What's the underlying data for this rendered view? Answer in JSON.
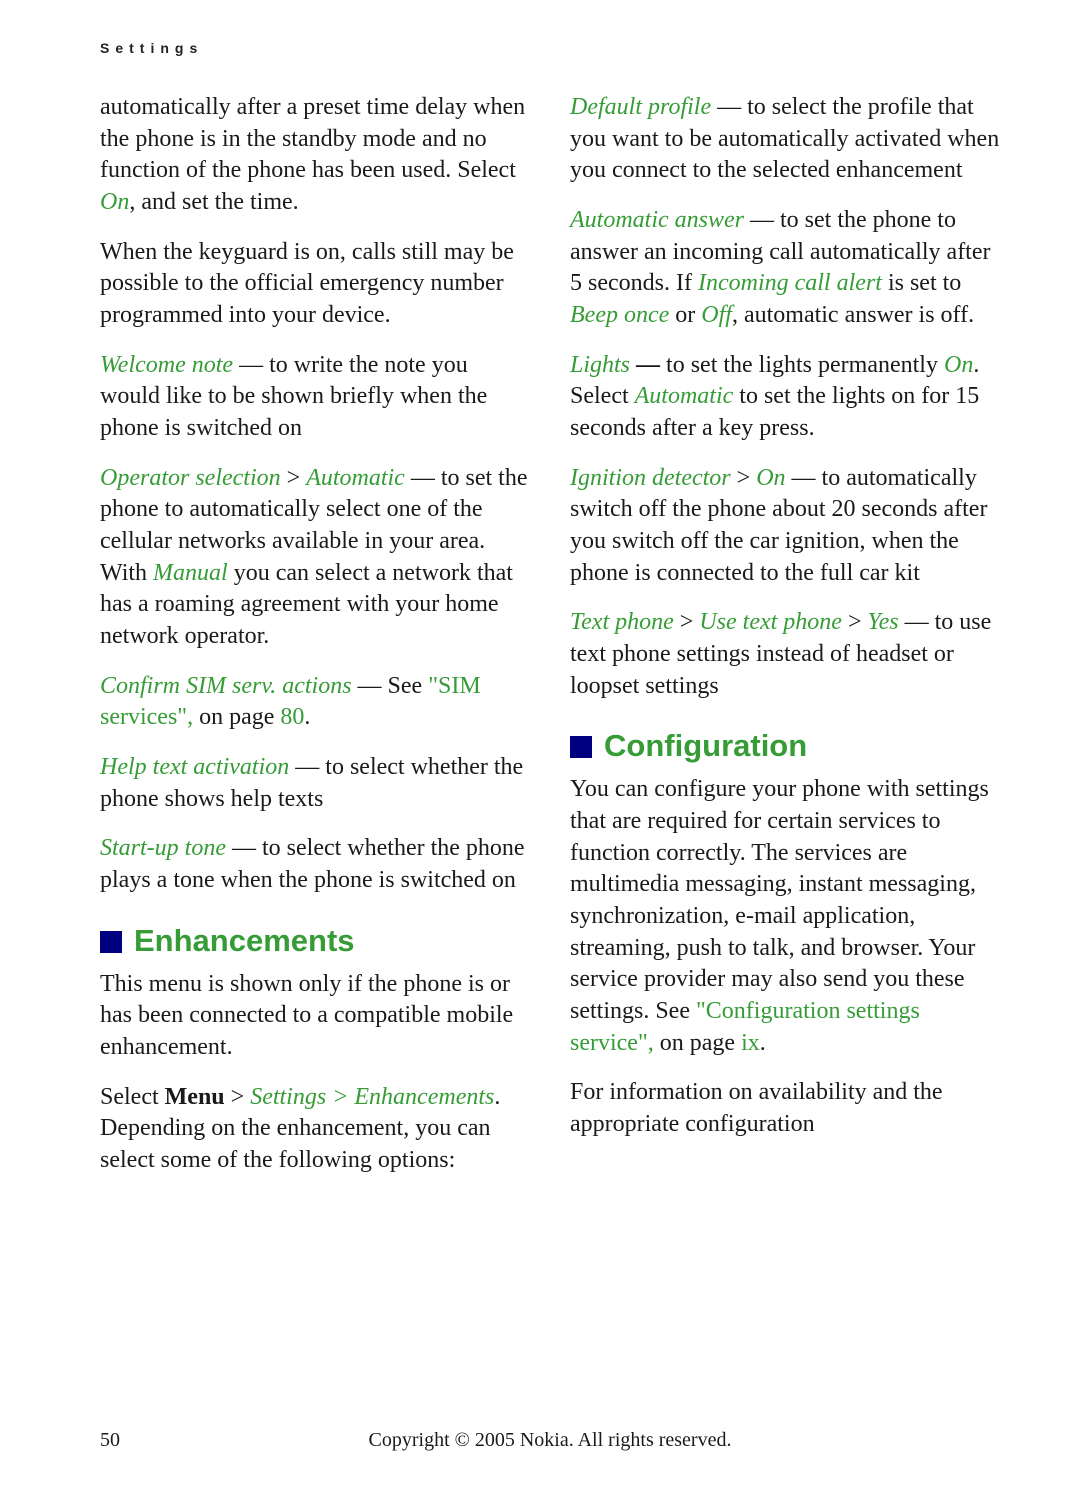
{
  "header": {
    "section": "Settings"
  },
  "left": {
    "p1a": "automatically after a preset time delay when the phone is in the standby mode and no function of the phone has been used. Select ",
    "p1b": "On",
    "p1c": ", and set the time.",
    "p2": "When the keyguard is on, calls still may be possible to the official emergency number programmed into your device.",
    "p3a": "Welcome note",
    "p3b": " — to write the note you would like to be shown briefly when the phone is switched on",
    "p4a": "Operator selection",
    "p4b": " > ",
    "p4c": "Automatic",
    "p4d": " — to set the phone to automatically select one of the cellular networks available in your area. With ",
    "p4e": "Manual",
    "p4f": " you can select a network that has a roaming agreement with your home network operator.",
    "p5a": "Confirm SIM serv. actions",
    "p5b": " — See ",
    "p5c": "\"SIM services\",",
    "p5d": " on page ",
    "p5e": "80",
    "p5f": ".",
    "p6a": "Help text activation",
    "p6b": " — to select whether the phone shows help texts",
    "p7a": "Start-up tone",
    "p7b": " — to select whether the phone plays a tone when the phone is switched on",
    "h_enh": "Enhancements",
    "p8": "This menu is shown only if the phone is or has been connected to a compatible mobile enhancement.",
    "p9a": "Select ",
    "p9b": "Menu",
    "p9c": " > ",
    "p9d": "Settings",
    "p9e": " > ",
    "p9f": "Enhancements",
    "p9g": ". Depending on the enhancement, you can select some of the following options:"
  },
  "right": {
    "p1a": "Default profile",
    "p1b": " — to select the profile that you want to be automatically activated when you connect to the selected enhancement",
    "p2a": "Automatic answer",
    "p2b": " — to set the phone to answer an incoming call automatically after 5 seconds. If ",
    "p2c": "Incoming call alert",
    "p2d": " is set to ",
    "p2e": "Beep once",
    "p2f": " or ",
    "p2g": "Off",
    "p2h": ", automatic answer is off.",
    "p3a": "Lights",
    "p3b": " — ",
    "p3c": "to set the lights permanently ",
    "p3d": "On",
    "p3e": ". Select ",
    "p3f": "Automatic",
    "p3g": " to set the lights on for 15 seconds after a key press.",
    "p4a": "Ignition detector",
    "p4b": " > ",
    "p4c": "On",
    "p4d": " — to automatically switch off the phone about 20 seconds after you switch off the car ignition, when the phone is connected to the full car kit",
    "p5a": "Text phone",
    "p5b": " > ",
    "p5c": "Use text phone",
    "p5d": " > ",
    "p5e": "Yes",
    "p5f": " — to use text phone settings instead of headset or loopset settings",
    "h_conf": "Configuration",
    "p6a": "You can configure your phone with settings that are required for certain services to function correctly. The services are multimedia messaging, instant messaging, synchronization, e-mail application, streaming, push to talk, and browser. Your service provider may also send you these settings. See ",
    "p6b": "\"Configuration settings service\",",
    "p6c": " on page ",
    "p6d": "ix",
    "p6e": ".",
    "p7": "For information on availability and the appropriate configuration"
  },
  "footer": {
    "page": "50",
    "copyright": "Copyright © 2005 Nokia. All rights reserved."
  }
}
